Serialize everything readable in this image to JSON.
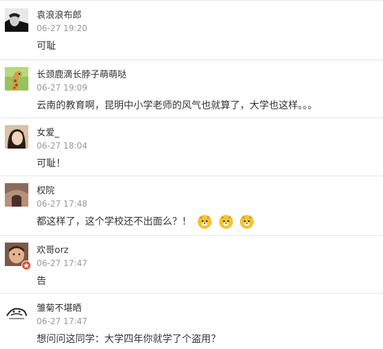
{
  "comments": [
    {
      "avatar_icon": "avatar-man-black-white-icon",
      "username": "袁浪浪布郎",
      "time": "06-27 19:20",
      "text": "可耻"
    },
    {
      "avatar_icon": "avatar-giraffe-icon",
      "username": "长颈鹿滴长脖子萌萌哒",
      "time": "06-27 19:09",
      "text": "云南的教育啊，昆明中小学老师的风气也就算了，大学也这样。。。"
    },
    {
      "avatar_icon": "avatar-girl-icon",
      "username": "女爱_",
      "time": "06-27 18:04",
      "text": "可耻！"
    },
    {
      "avatar_icon": "avatar-back-icon",
      "username": "权院",
      "time": "06-27 17:48",
      "text": "都这样了，这个学校还不出面么？！",
      "emojis": [
        "dog-face-emoji-icon",
        "dog-face-emoji-icon",
        "dog-face-emoji-icon"
      ]
    },
    {
      "avatar_icon": "avatar-baby-icon",
      "username": "欢哥orz",
      "time": "06-27 17:47",
      "text": "告",
      "badge_icon": "verified-badge-icon"
    },
    {
      "avatar_icon": "avatar-sketch-icon",
      "username": "雏菊不堪晒",
      "time": "06-27 17:47",
      "text": "想问问这同学：大学四年你就学了个盗用？"
    }
  ],
  "colors": {
    "divider": "#e6e6e6",
    "time_text": "#999999",
    "main_text": "#333333",
    "emoji_yellow": "#f4c430",
    "badge_red": "#e94b35"
  }
}
